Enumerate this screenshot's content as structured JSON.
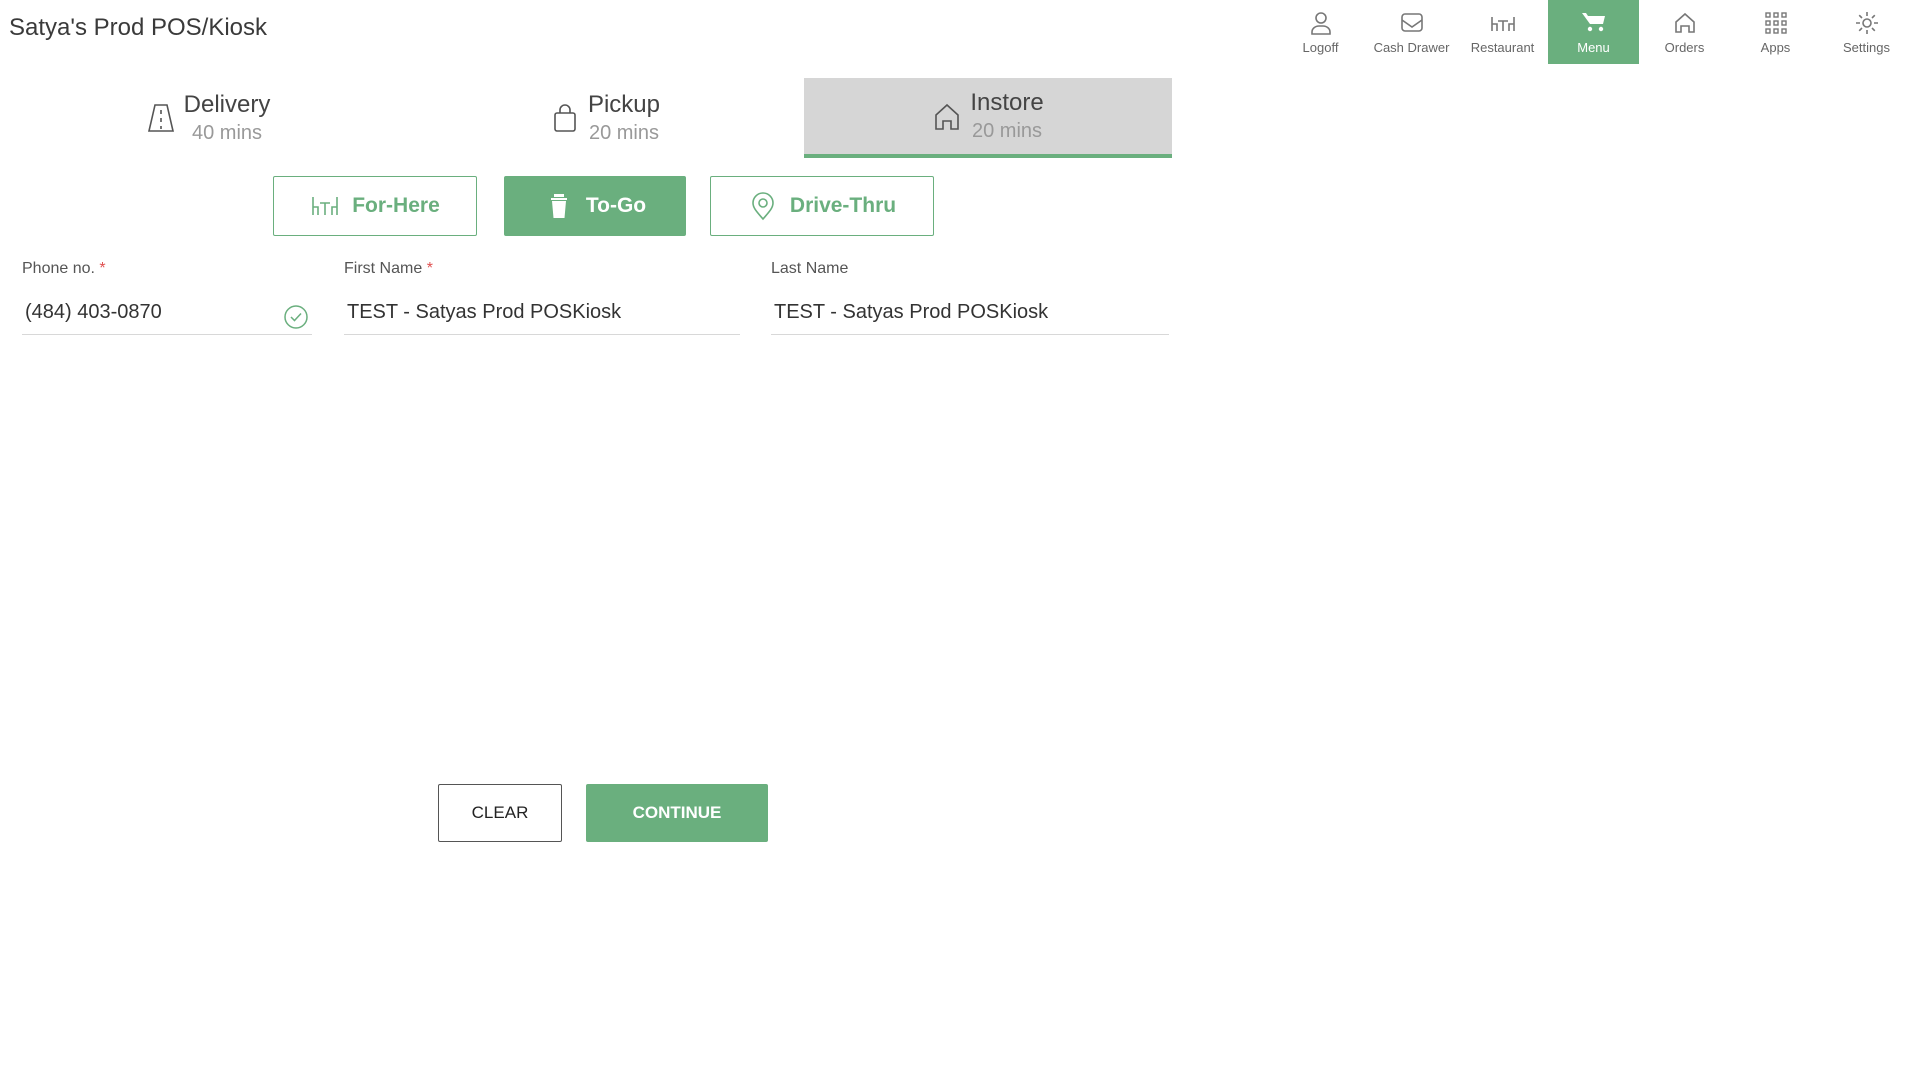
{
  "app": {
    "title": "Satya's Prod POS/Kiosk"
  },
  "topnav": [
    {
      "label": "Logoff",
      "icon": "user-icon",
      "active": false
    },
    {
      "label": "Cash Drawer",
      "icon": "cash-drawer-icon",
      "active": false
    },
    {
      "label": "Restaurant",
      "icon": "restaurant-icon",
      "active": false
    },
    {
      "label": "Menu",
      "icon": "cart-icon",
      "active": true
    },
    {
      "label": "Orders",
      "icon": "home-icon",
      "active": false
    },
    {
      "label": "Apps",
      "icon": "apps-grid-icon",
      "active": false
    },
    {
      "label": "Settings",
      "icon": "gear-icon",
      "active": false
    }
  ],
  "order_types": [
    {
      "name": "Delivery",
      "time": "40 mins",
      "icon": "road-icon",
      "active": false
    },
    {
      "name": "Pickup",
      "time": "20 mins",
      "icon": "bag-icon",
      "active": false
    },
    {
      "name": "Instore",
      "time": "20 mins",
      "icon": "store-icon",
      "active": true
    }
  ],
  "sub_options": [
    {
      "label": "For-Here",
      "icon": "dining-table-icon",
      "active": false
    },
    {
      "label": "To-Go",
      "icon": "togo-cup-icon",
      "active": true
    },
    {
      "label": "Drive-Thru",
      "icon": "location-pin-icon",
      "active": false
    }
  ],
  "form": {
    "phone": {
      "label": "Phone no.",
      "required_mark": "*",
      "value": "(484) 403-0870",
      "verified": true
    },
    "first_name": {
      "label": "First Name",
      "required_mark": "*",
      "value": "TEST - Satyas Prod POSKiosk"
    },
    "last_name": {
      "label": "Last Name",
      "value": "TEST - Satyas Prod POSKiosk"
    }
  },
  "actions": {
    "clear_label": "CLEAR",
    "continue_label": "CONTINUE"
  },
  "colors": {
    "accent": "#6aaf7e",
    "selected_tab_bg": "#d6d6d6",
    "required": "#e05050"
  }
}
